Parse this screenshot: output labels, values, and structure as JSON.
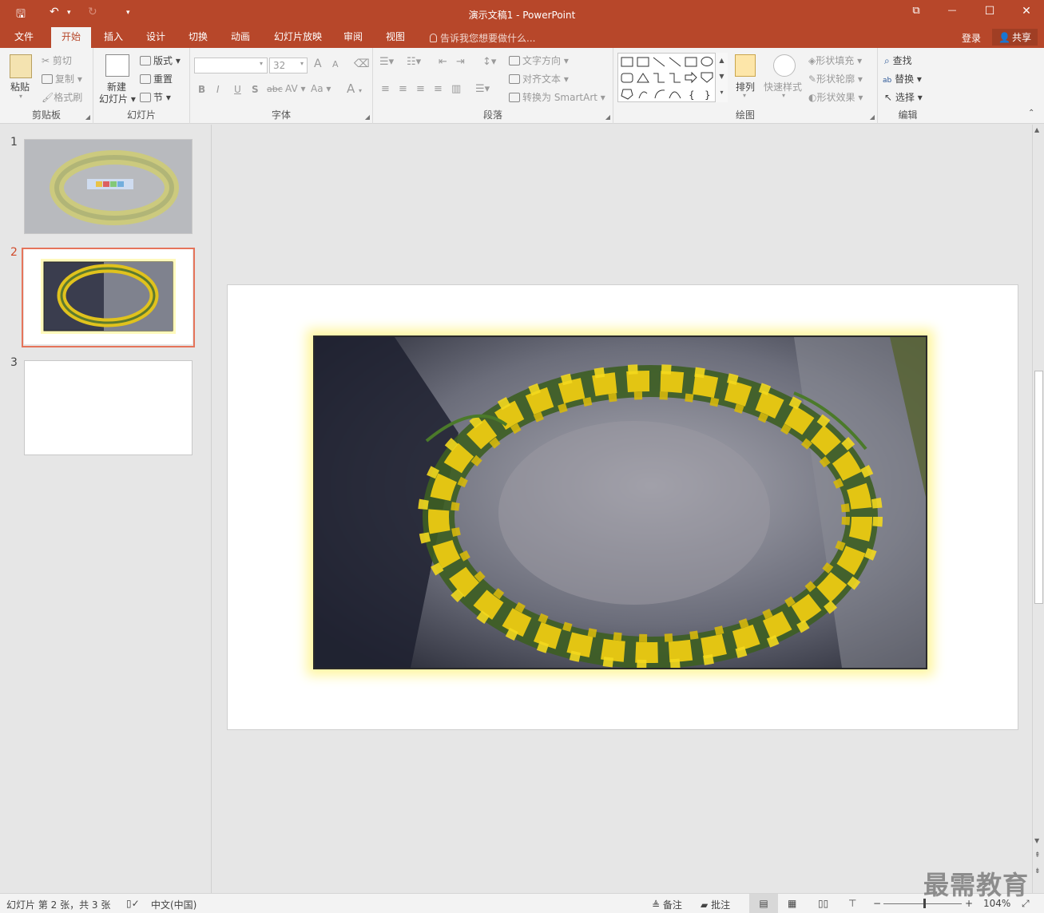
{
  "titlebar": {
    "title": "演示文稿1 - PowerPoint",
    "qa_save": "🖫",
    "qa_undo": "↶",
    "qa_undo_more": "▾",
    "qa_redo": "↻",
    "qa_customize": "▾",
    "ribbon_display": "⧉",
    "minimize": "—",
    "maximize": "☐",
    "close": "✕"
  },
  "tabs": [
    {
      "label": "文件"
    },
    {
      "label": "开始"
    },
    {
      "label": "插入"
    },
    {
      "label": "设计"
    },
    {
      "label": "切换"
    },
    {
      "label": "动画"
    },
    {
      "label": "幻灯片放映"
    },
    {
      "label": "审阅"
    },
    {
      "label": "视图"
    }
  ],
  "active_tab": "开始",
  "tellme": "告诉我您想要做什么...",
  "login": "登录",
  "share": "共享",
  "ribbon": {
    "clipboard": {
      "label": "剪贴板",
      "paste": "粘贴",
      "cut": "剪切",
      "copy": "复制",
      "format_painter": "格式刷"
    },
    "slides": {
      "label": "幻灯片",
      "new_slide_line1": "新建",
      "new_slide_line2": "幻灯片",
      "layout": "版式",
      "reset": "重置",
      "section": "节"
    },
    "font": {
      "label": "字体",
      "font_name": "",
      "font_size": "32",
      "bold": "B",
      "italic": "I",
      "underline": "U",
      "shadow": "S",
      "strike": "abc",
      "spacing": "AV",
      "case": "Aa",
      "color": "A",
      "grow": "A",
      "shrink": "A"
    },
    "paragraph": {
      "label": "段落",
      "text_direction": "文字方向",
      "align_text": "对齐文本",
      "smartart": "转换为 SmartArt"
    },
    "drawing": {
      "label": "绘图",
      "arrange": "排列",
      "quick_styles": "快速样式",
      "shape_fill": "形状填充",
      "shape_outline": "形状轮廓",
      "shape_effects": "形状效果"
    },
    "editing": {
      "label": "编辑",
      "find": "查找",
      "replace": "替换",
      "select": "选择"
    }
  },
  "slides_panel": {
    "slides": [
      {
        "number": "1"
      },
      {
        "number": "2"
      },
      {
        "number": "3"
      }
    ],
    "selected": 2
  },
  "statusbar": {
    "slide_info": "幻灯片 第 2 张，共 3 张",
    "language": "中文(中国)",
    "notes": "备注",
    "comments": "批注",
    "zoom_minus": "−",
    "zoom_plus": "+",
    "zoom": "104%",
    "zoom_level_fraction": 0.52
  },
  "watermark": "最需教育",
  "colors": {
    "accent": "#b7472a",
    "selection": "#e5745a",
    "glow": "#fff6a0"
  }
}
